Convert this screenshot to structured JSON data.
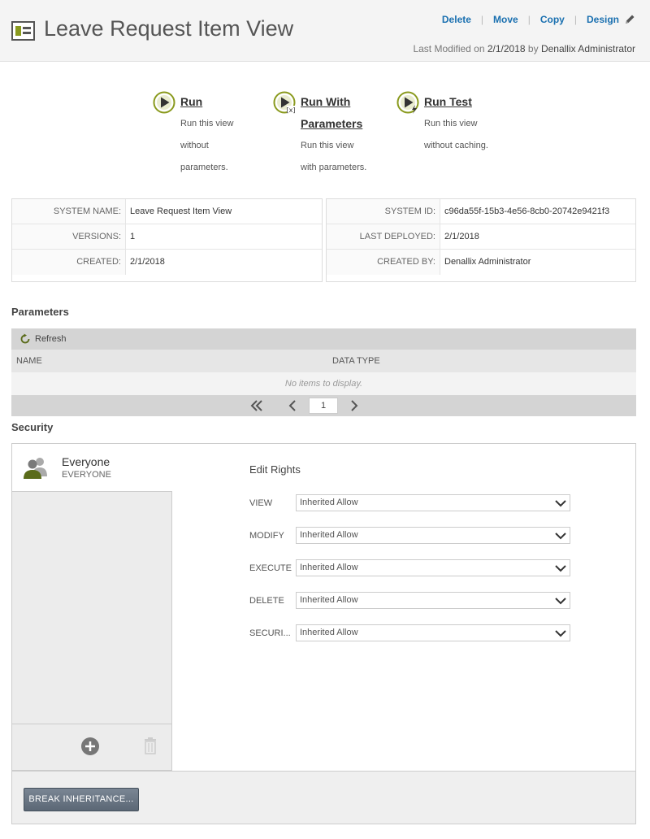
{
  "header": {
    "title": "Leave Request Item View",
    "actions": [
      "Delete",
      "Move",
      "Copy",
      "Design"
    ],
    "modified_prefix": "Last Modified on",
    "modified_date": "2/1/2018",
    "modified_by_word": "by",
    "modified_by": "Denallix Administrator"
  },
  "run_buttons": [
    {
      "title": "Run",
      "desc": [
        "Run this view",
        "without",
        "parameters."
      ]
    },
    {
      "title": "Run With Parameters",
      "title_lines": [
        "Run With",
        "Parameters"
      ],
      "desc": [
        "Run this view",
        "with parameters."
      ]
    },
    {
      "title": "Run Test",
      "desc": [
        "Run this view",
        "without caching."
      ]
    }
  ],
  "properties_left": [
    {
      "label": "SYSTEM NAME:",
      "value": "Leave Request Item View"
    },
    {
      "label": "VERSIONS:",
      "value": "1"
    },
    {
      "label": "CREATED:",
      "value": "2/1/2018"
    }
  ],
  "properties_right": [
    {
      "label": "SYSTEM ID:",
      "value": "c96da55f-15b3-4e56-8cb0-20742e9421f3"
    },
    {
      "label": "LAST DEPLOYED:",
      "value": "2/1/2018"
    },
    {
      "label": "CREATED BY:",
      "value": "Denallix Administrator"
    }
  ],
  "parameters": {
    "title": "Parameters",
    "refresh_label": "Refresh",
    "columns": [
      "NAME",
      "DATA TYPE"
    ],
    "empty_text": "No items to display.",
    "page": "1"
  },
  "security": {
    "title": "Security",
    "user_name": "Everyone",
    "user_sub": "EVERYONE",
    "edit_rights_title": "Edit Rights",
    "rights": [
      {
        "label": "VIEW",
        "value": "Inherited Allow"
      },
      {
        "label": "MODIFY",
        "value": "Inherited Allow"
      },
      {
        "label": "EXECUTE",
        "value": "Inherited Allow"
      },
      {
        "label": "DELETE",
        "value": "Inherited Allow"
      },
      {
        "label": "SECURI...",
        "value": "Inherited Allow"
      }
    ],
    "break_button": "BREAK INHERITANCE..."
  },
  "colors": {
    "accent_olive": "#8a9a1e",
    "link_blue": "#1a70b0"
  }
}
